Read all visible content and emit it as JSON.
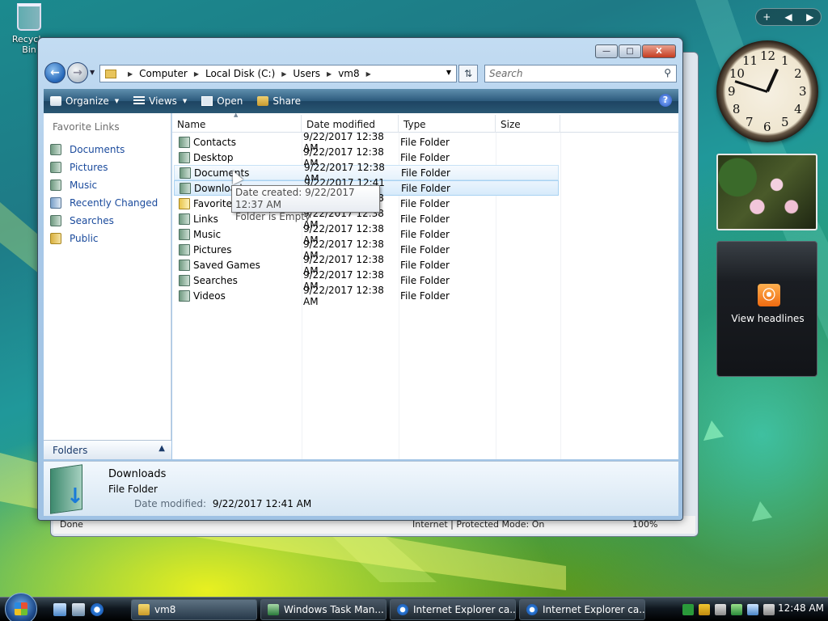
{
  "desktop": {
    "recycle_label": "Recycle Bin"
  },
  "background_window": {
    "status_left": "Done",
    "status_mid": "Internet | Protected Mode: On",
    "zoom": "100%"
  },
  "window": {
    "caption": {
      "minimize": "—",
      "maximize": "□",
      "close": "X"
    },
    "address": {
      "crumbs": [
        "Computer",
        "Local Disk (C:)",
        "Users",
        "vm8"
      ]
    },
    "search": {
      "placeholder": "Search"
    },
    "toolbar": {
      "organize": "Organize",
      "views": "Views",
      "open": "Open",
      "share": "Share",
      "help": "?"
    },
    "nav": {
      "heading": "Favorite Links",
      "links": [
        "Documents",
        "Pictures",
        "Music",
        "Recently Changed",
        "Searches",
        "Public"
      ],
      "folders_label": "Folders"
    },
    "columns": {
      "name": "Name",
      "date": "Date modified",
      "type": "Type",
      "size": "Size"
    },
    "rows": [
      {
        "name": "Contacts",
        "date": "9/22/2017 12:38 AM",
        "type": "File Folder"
      },
      {
        "name": "Desktop",
        "date": "9/22/2017 12:38 AM",
        "type": "File Folder"
      },
      {
        "name": "Documents",
        "date": "9/22/2017 12:38 AM",
        "type": "File Folder"
      },
      {
        "name": "Downloads",
        "date": "9/22/2017 12:41 AM",
        "type": "File Folder"
      },
      {
        "name": "Favorites",
        "date": "9/22/2017 12:38 AM",
        "type": "File Folder"
      },
      {
        "name": "Links",
        "date": "9/22/2017 12:38 AM",
        "type": "File Folder"
      },
      {
        "name": "Music",
        "date": "9/22/2017 12:38 AM",
        "type": "File Folder"
      },
      {
        "name": "Pictures",
        "date": "9/22/2017 12:38 AM",
        "type": "File Folder"
      },
      {
        "name": "Saved Games",
        "date": "9/22/2017 12:38 AM",
        "type": "File Folder"
      },
      {
        "name": "Searches",
        "date": "9/22/2017 12:38 AM",
        "type": "File Folder"
      },
      {
        "name": "Videos",
        "date": "9/22/2017 12:38 AM",
        "type": "File Folder"
      }
    ],
    "tooltip": {
      "line1": "Date created: 9/22/2017 12:37 AM",
      "line2": "Folder is Empty"
    },
    "details": {
      "name": "Downloads",
      "type": "File Folder",
      "modified_label": "Date modified:",
      "modified_value": "9/22/2017 12:41 AM"
    }
  },
  "gadgets": {
    "sidebar_controls": [
      "+",
      "◀",
      "▶"
    ],
    "clock_numbers": [
      "12",
      "1",
      "2",
      "3",
      "4",
      "5",
      "6",
      "7",
      "8",
      "9",
      "10",
      "11"
    ],
    "clock_time": "12:48",
    "feed_label": "View headlines"
  },
  "taskbar": {
    "buttons": [
      "vm8",
      "Windows Task Man...",
      "Internet Explorer ca...",
      "Internet Explorer ca..."
    ],
    "time": "12:48 AM"
  }
}
